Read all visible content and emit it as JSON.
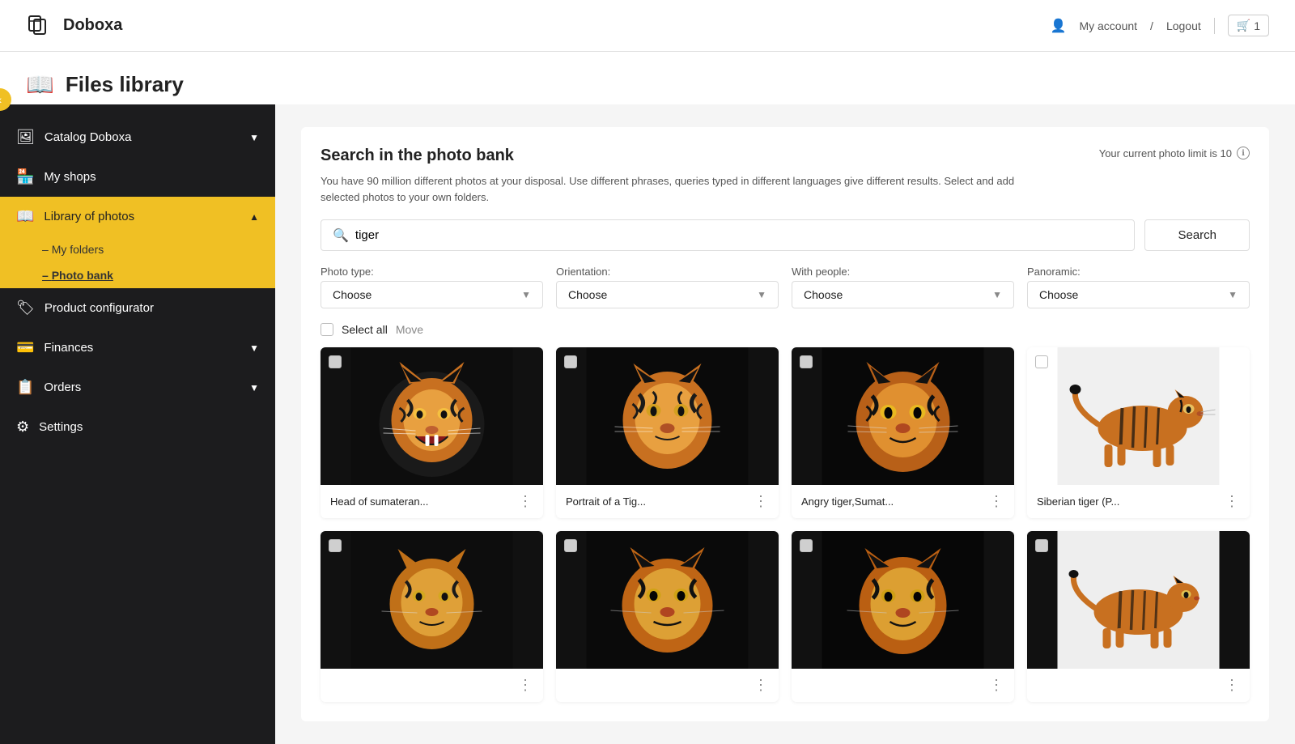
{
  "header": {
    "logo_text": "Doboxa",
    "my_account": "My account",
    "logout": "Logout",
    "cart_count": "1"
  },
  "page_title": "Files library",
  "sidebar": {
    "back_btn": "‹",
    "items": [
      {
        "id": "catalog",
        "label": "Catalog Doboxa",
        "icon": "🖼",
        "has_chevron": true,
        "active": false
      },
      {
        "id": "myshops",
        "label": "My shops",
        "icon": "🏪",
        "has_chevron": false,
        "active": false
      },
      {
        "id": "library",
        "label": "Library of photos",
        "icon": "📖",
        "has_chevron": true,
        "active": true,
        "subitems": [
          {
            "id": "myfolders",
            "label": "My folders",
            "active": false
          },
          {
            "id": "photobank",
            "label": "Photo bank",
            "active": true
          }
        ]
      },
      {
        "id": "productconfig",
        "label": "Product configurator",
        "icon": "🏷",
        "has_chevron": false,
        "active": false
      },
      {
        "id": "finances",
        "label": "Finances",
        "icon": "💳",
        "has_chevron": true,
        "active": false
      },
      {
        "id": "orders",
        "label": "Orders",
        "icon": "📋",
        "has_chevron": true,
        "active": false
      },
      {
        "id": "settings",
        "label": "Settings",
        "icon": "⚙",
        "has_chevron": false,
        "active": false
      }
    ]
  },
  "main": {
    "search_section": {
      "title": "Search in the photo bank",
      "photo_limit_text": "Your current photo limit is 10",
      "description": "You have 90 million different photos at your disposal. Use different phrases, queries typed in different languages give different results. Select and add selected photos to your own folders.",
      "search_placeholder": "tiger",
      "search_value": "tiger",
      "search_btn": "Search",
      "filters": [
        {
          "id": "photo_type",
          "label": "Photo type:",
          "value": "Choose"
        },
        {
          "id": "orientation",
          "label": "Orientation:",
          "value": "Choose"
        },
        {
          "id": "with_people",
          "label": "With people:",
          "value": "Choose"
        },
        {
          "id": "panoramic",
          "label": "Panoramic:",
          "value": "Choose"
        }
      ],
      "select_all_label": "Select all",
      "move_label": "Move"
    },
    "photos": [
      {
        "id": 1,
        "title": "Head of sumateran...",
        "type": "dark_roaring"
      },
      {
        "id": 2,
        "title": "Portrait of a Tig...",
        "type": "dark_portrait"
      },
      {
        "id": 3,
        "title": "Angry tiger,Sumat...",
        "type": "dark_angry"
      },
      {
        "id": 4,
        "title": "Siberian tiger (P...",
        "type": "white_walking"
      },
      {
        "id": 5,
        "title": "",
        "type": "dark_roaring2"
      },
      {
        "id": 6,
        "title": "",
        "type": "dark_portrait2"
      },
      {
        "id": 7,
        "title": "",
        "type": "dark_angry2"
      },
      {
        "id": 8,
        "title": "",
        "type": "white_walking2"
      }
    ]
  }
}
